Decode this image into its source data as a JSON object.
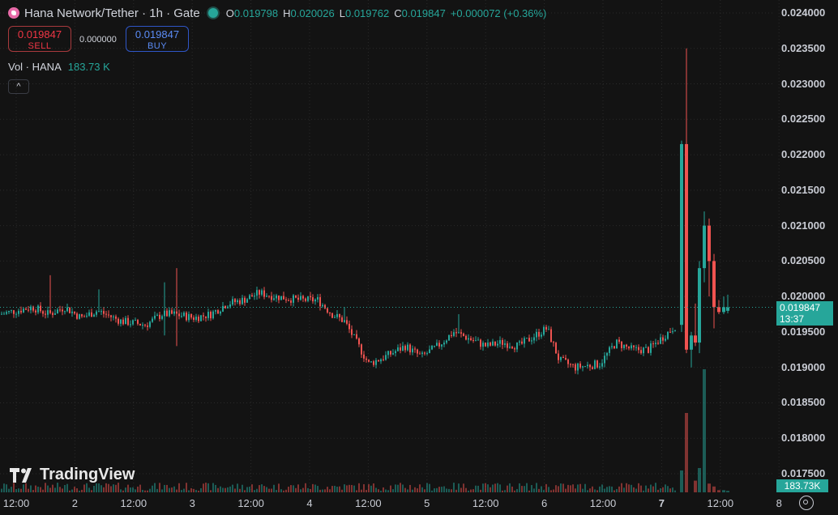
{
  "header": {
    "symbol": "Hana Network/Tether · 1h · Gate",
    "open_key": "O",
    "open": "0.019798",
    "high_key": "H",
    "high": "0.020026",
    "low_key": "L",
    "low": "0.019762",
    "close_key": "C",
    "close": "0.019847",
    "change": "+0.000072 (+0.36%)"
  },
  "trade": {
    "sell_price": "0.019847",
    "sell_label": "SELL",
    "spread": "0.000000",
    "buy_price": "0.019847",
    "buy_label": "BUY"
  },
  "volume": {
    "label": "Vol · HANA",
    "value": "183.73 K",
    "tag": "183.73K"
  },
  "collapse_icon": "^",
  "price_axis": [
    "0.024000",
    "0.023500",
    "0.023000",
    "0.022500",
    "0.022000",
    "0.021500",
    "0.021000",
    "0.020500",
    "0.020000",
    "0.019500",
    "0.019000",
    "0.018500",
    "0.018000",
    "0.017500"
  ],
  "time_axis": [
    "12:00",
    "2",
    "12:00",
    "3",
    "12:00",
    "4",
    "12:00",
    "5",
    "12:00",
    "6",
    "12:00",
    "7",
    "12:00",
    "8"
  ],
  "current_price": {
    "price": "0.019847",
    "countdown": "13:37"
  },
  "logo_text": "TradingView",
  "colors": {
    "up": "#26a69a",
    "down": "#ef5350",
    "background": "#131313",
    "grid": "#2a2a2a"
  },
  "chart_data": {
    "type": "candlestick",
    "interval": "1h",
    "ylim": [
      0.0172,
      0.0242
    ],
    "x_axis_labels": [
      "12:00",
      "2",
      "12:00",
      "3",
      "12:00",
      "4",
      "12:00",
      "5",
      "12:00",
      "6",
      "12:00",
      "7",
      "12:00",
      "8"
    ],
    "y_axis_labels": [
      "0.024000",
      "0.023500",
      "0.023000",
      "0.022500",
      "0.022000",
      "0.021500",
      "0.021000",
      "0.020500",
      "0.020000",
      "0.019500",
      "0.019000",
      "0.018500",
      "0.018000",
      "0.017500"
    ]
  }
}
